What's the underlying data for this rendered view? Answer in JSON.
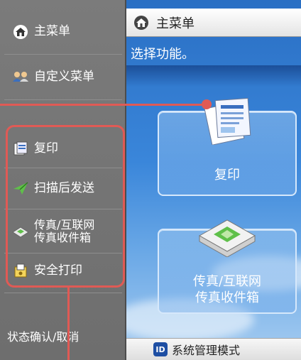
{
  "sidebar": {
    "items": [
      {
        "label": "主菜单",
        "icon": "home-icon"
      },
      {
        "label": "自定义菜单",
        "icon": "users-icon"
      },
      {
        "label": "复印",
        "icon": "copy-icon"
      },
      {
        "label": "扫描后发送",
        "icon": "send-icon"
      },
      {
        "label": "传真/互联网\n传真收件箱",
        "icon": "fax-icon"
      },
      {
        "label": "安全打印",
        "icon": "secure-print-icon"
      },
      {
        "label": "状态确认/取消",
        "icon": ""
      }
    ]
  },
  "main": {
    "title": "主菜单",
    "instruction": "选择功能。",
    "buttons": [
      {
        "label": "复印",
        "icon": "copy-icon"
      },
      {
        "label": "传真/互联网\n传真收件箱",
        "icon": "fax-icon"
      }
    ]
  },
  "footer": {
    "badge": "ID",
    "label": "系统管理模式"
  },
  "colors": {
    "annotation": "#e05a55",
    "sidebar_bg": "#757575",
    "main_bg": "#3a86da"
  }
}
